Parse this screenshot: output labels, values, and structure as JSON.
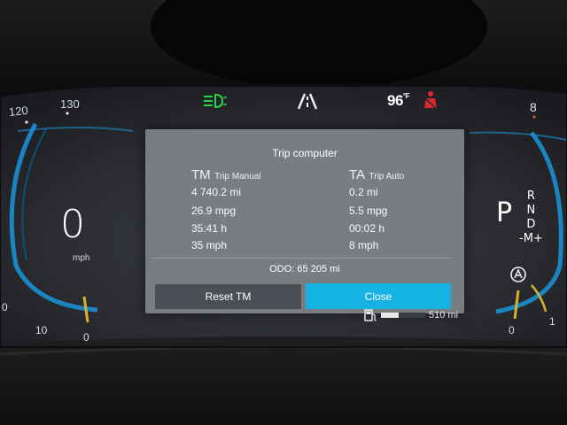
{
  "cluster": {
    "speedo_ticks": [
      "120",
      "130",
      "0",
      "10",
      "0"
    ],
    "speed": "0",
    "speed_unit": "mph",
    "outside_temp": "96",
    "temp_unit": "°F",
    "right_gauge_top": "8",
    "right_gauge_ticks": [
      "0",
      "1"
    ],
    "gear_selected": "P",
    "gear_list": "R\nN\nD\n-M+",
    "fuel_level": 0.4,
    "range": "510 mi",
    "colors": {
      "accent_blue": "#15b3e4",
      "gauge_ring": "#1a8fd4",
      "headlight_indicator": "#2bd34a",
      "warning_red": "#e0252a",
      "needle": "#d9b233"
    },
    "icons": [
      "headlight-indicator-icon",
      "lane-assist-icon",
      "seatbelt-warning-icon",
      "fuel-pump-icon",
      "drive-mode-icon"
    ]
  },
  "trip_computer": {
    "title": "Trip computer",
    "manual": {
      "abbr": "TM",
      "label": "Trip Manual",
      "distance": "4 740.2 mi",
      "consumption": "26.9 mpg",
      "time": "35:41 h",
      "avg_speed": "35 mph"
    },
    "auto": {
      "abbr": "TA",
      "label": "Trip Auto",
      "distance": "0.2 mi",
      "consumption": "5.5 mpg",
      "time": "00:02 h",
      "avg_speed": "8 mph"
    },
    "odometer": "ODO: 65 205 mi",
    "reset_label": "Reset TM",
    "close_label": "Close"
  }
}
